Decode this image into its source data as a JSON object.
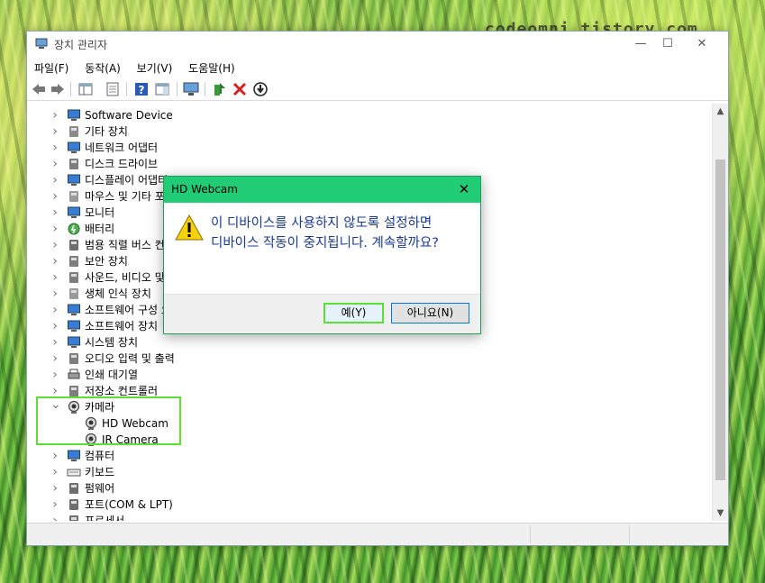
{
  "watermark": "codeomni.tistory.com",
  "window": {
    "title": "장치 관리자",
    "controls": {
      "minimize": "—",
      "maximize": "☐",
      "close": "✕"
    }
  },
  "menu": [
    "파일(F)",
    "동작(A)",
    "보기(V)",
    "도움말(H)"
  ],
  "tree": {
    "items": [
      {
        "label": "Software Device",
        "icon": "software-device-icon"
      },
      {
        "label": "기타 장치",
        "icon": "other-device-icon"
      },
      {
        "label": "네트워크 어댑터",
        "icon": "network-adapter-icon"
      },
      {
        "label": "디스크 드라이브",
        "icon": "disk-drive-icon"
      },
      {
        "label": "디스플레이 어댑터",
        "icon": "display-adapter-icon"
      },
      {
        "label": "마우스 및 기타 포인팅 장치",
        "icon": "mouse-icon"
      },
      {
        "label": "모니터",
        "icon": "monitor-icon"
      },
      {
        "label": "배터리",
        "icon": "battery-icon"
      },
      {
        "label": "범용 직렬 버스 컨트롤러",
        "icon": "usb-icon"
      },
      {
        "label": "보안 장치",
        "icon": "security-device-icon"
      },
      {
        "label": "사운드, 비디오 및 게임 컨트롤러",
        "icon": "sound-icon"
      },
      {
        "label": "생체 인식 장치",
        "icon": "biometric-icon"
      },
      {
        "label": "소프트웨어 구성 요소",
        "icon": "software-component-icon"
      },
      {
        "label": "소프트웨어 장치",
        "icon": "software-device-icon"
      },
      {
        "label": "시스템 장치",
        "icon": "system-device-icon"
      },
      {
        "label": "오디오 입력 및 출력",
        "icon": "audio-icon"
      },
      {
        "label": "인쇄 대기열",
        "icon": "printer-icon"
      },
      {
        "label": "저장소 컨트롤러",
        "icon": "storage-controller-icon"
      },
      {
        "label": "카메라",
        "icon": "camera-icon",
        "expanded": true
      },
      {
        "label": "HD Webcam",
        "icon": "webcam-icon",
        "child": true
      },
      {
        "label": "IR Camera",
        "icon": "webcam-icon",
        "child": true
      },
      {
        "label": "컴퓨터",
        "icon": "computer-icon"
      },
      {
        "label": "키보드",
        "icon": "keyboard-icon"
      },
      {
        "label": "펌웨어",
        "icon": "firmware-icon"
      },
      {
        "label": "포트(COM & LPT)",
        "icon": "port-icon"
      },
      {
        "label": "프로세서",
        "icon": "processor-icon"
      }
    ]
  },
  "dialog": {
    "title": "HD Webcam",
    "message": "이 디바이스를 사용하지 않도록 설정하면 디바이스 작동이 중지됩니다. 계속할까요?",
    "yes_label": "예(Y)",
    "no_label": "아니요(N)",
    "icon": "warning-icon"
  },
  "colors": {
    "dialog_title_bg": "#21cc76",
    "highlight": "#5de034",
    "message_text": "#1a3a8e"
  }
}
